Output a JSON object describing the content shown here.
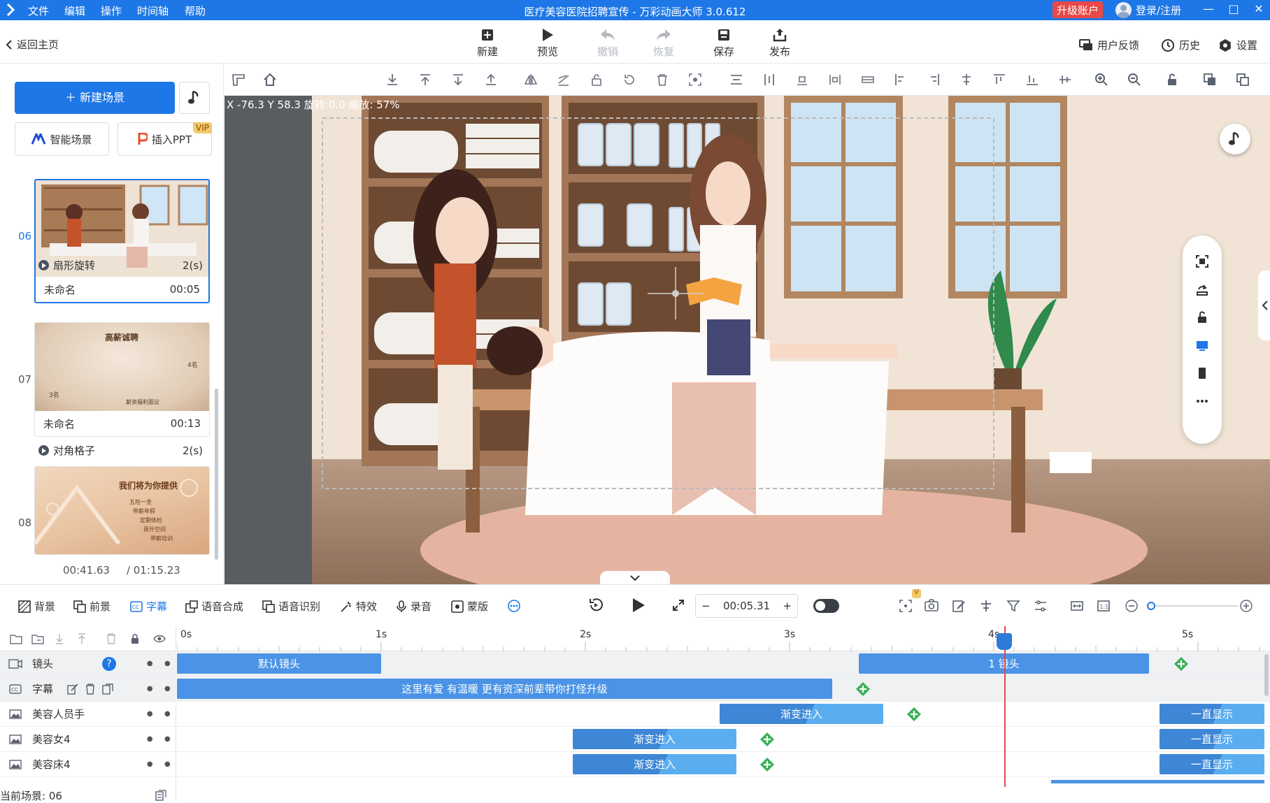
{
  "app": {
    "title": "医疗美容医院招聘宣传 - 万彩动画大师 3.0.612",
    "menu": [
      "文件",
      "编辑",
      "操作",
      "时间轴",
      "帮助"
    ],
    "upgrade": "升级账户",
    "login": "登录/注册",
    "accent": "#1e77e6"
  },
  "toolbar": {
    "back": "返回主页",
    "new": "新建",
    "preview": "预览",
    "undo": "撤销",
    "redo": "恢复",
    "save": "保存",
    "publish": "发布",
    "feedback": "用户反馈",
    "history": "历史",
    "settings": "设置"
  },
  "left_panel": {
    "new_scene": "新建场景",
    "smart_scene": "智能场景",
    "insert_ppt": "插入PPT",
    "vip": "VIP",
    "scenes": [
      {
        "num": "06",
        "name": "未命名",
        "duration": "00:05",
        "active": true
      },
      {
        "num": "07",
        "name": "未命名",
        "duration": "00:13",
        "thumb_title": "高薪诚聘",
        "thumb_texts": [
          "4名",
          "3名",
          "薪资福利面议"
        ]
      },
      {
        "num": "08",
        "thumb_title": "我们将为你提供",
        "thumb_texts": [
          "五险一金",
          "带薪年假",
          "定期体检",
          "晋升空间",
          "带薪培训"
        ]
      }
    ],
    "transitions": [
      {
        "name": "扇形旋转",
        "duration": "2(s)"
      },
      {
        "name": "对角格子",
        "duration": "2(s)"
      }
    ],
    "time_current": "00:41.63",
    "time_total": "/ 01:15.23"
  },
  "canvas": {
    "coords": "X -76.3 Y 58.3 旋转:0.0 缩放: 57%"
  },
  "bottom_toolbar": {
    "items": [
      "背景",
      "前景",
      "字幕",
      "语音合成",
      "语音识别",
      "特效",
      "录音",
      "蒙版"
    ],
    "time": "00:05.31"
  },
  "timeline": {
    "ruler": [
      "0s",
      "1s",
      "2s",
      "3s",
      "4s",
      "5s"
    ],
    "tracks": [
      {
        "name": "镜头",
        "clips": [
          "默认镜头",
          "1 镜头"
        ]
      },
      {
        "name": "字幕",
        "clips": [
          "这里有爱 有温暖 更有资深前辈带你打怪升级"
        ]
      },
      {
        "name": "美容人员手",
        "clips": [
          "渐变进入",
          "一直显示"
        ]
      },
      {
        "name": "美容女4",
        "clips": [
          "渐变进入",
          "一直显示"
        ]
      },
      {
        "name": "美容床4",
        "clips": [
          "渐变进入",
          "一直显示"
        ]
      }
    ],
    "current_scene": "当前场景: 06"
  }
}
